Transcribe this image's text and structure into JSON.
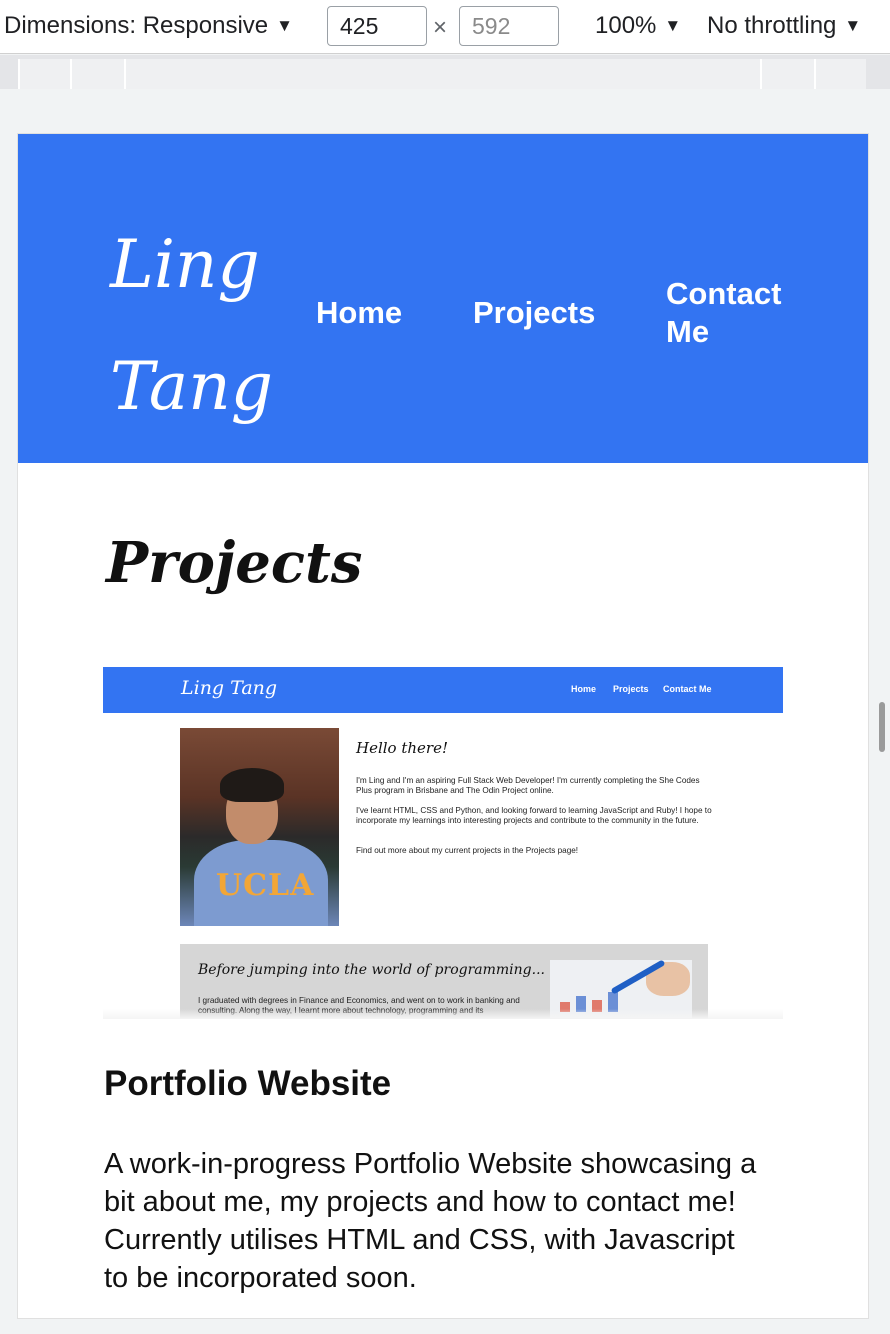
{
  "devtools": {
    "dimensions_label": "Dimensions: Responsive",
    "caret": "▼",
    "width_value": "425",
    "height_placeholder": "592",
    "times": "×",
    "zoom": "100%",
    "throttling": "No throttling"
  },
  "site": {
    "logo_line1": "Ling",
    "logo_line2": "Tang",
    "nav": {
      "home": "Home",
      "projects": "Projects",
      "contact_line1": "Contact",
      "contact_line2": "Me"
    },
    "accent_color": "#3374f2",
    "page_title": "Projects"
  },
  "thumbnail": {
    "logo": "Ling Tang",
    "nav": {
      "home": "Home",
      "projects": "Projects",
      "contact": "Contact Me"
    },
    "photo_text": "UCLA",
    "hello": "Hello there!",
    "para1": "I'm Ling and I'm an aspiring Full Stack Web Developer! I'm currently completing the She Codes Plus program in Brisbane and The Odin Project online.",
    "para2": "I've learnt HTML, CSS and Python, and looking forward to learning JavaScript and Ruby! I hope to incorporate my learnings into interesting projects and contribute to the community in the future.",
    "para3": "Find out more about my current projects in the Projects page!",
    "box_title": "Before jumping into the world of programming...",
    "box_text": "I graduated with degrees in Finance and Economics, and went on to work in banking and consulting. Along the way, I learnt more about technology, programming and its"
  },
  "project": {
    "name": "Portfolio Website",
    "description": "A work-in-progress Portfolio Website showcasing a bit about me, my projects and how to contact me! Currently utilises HTML and CSS, with Javascript to be incorporated soon."
  }
}
